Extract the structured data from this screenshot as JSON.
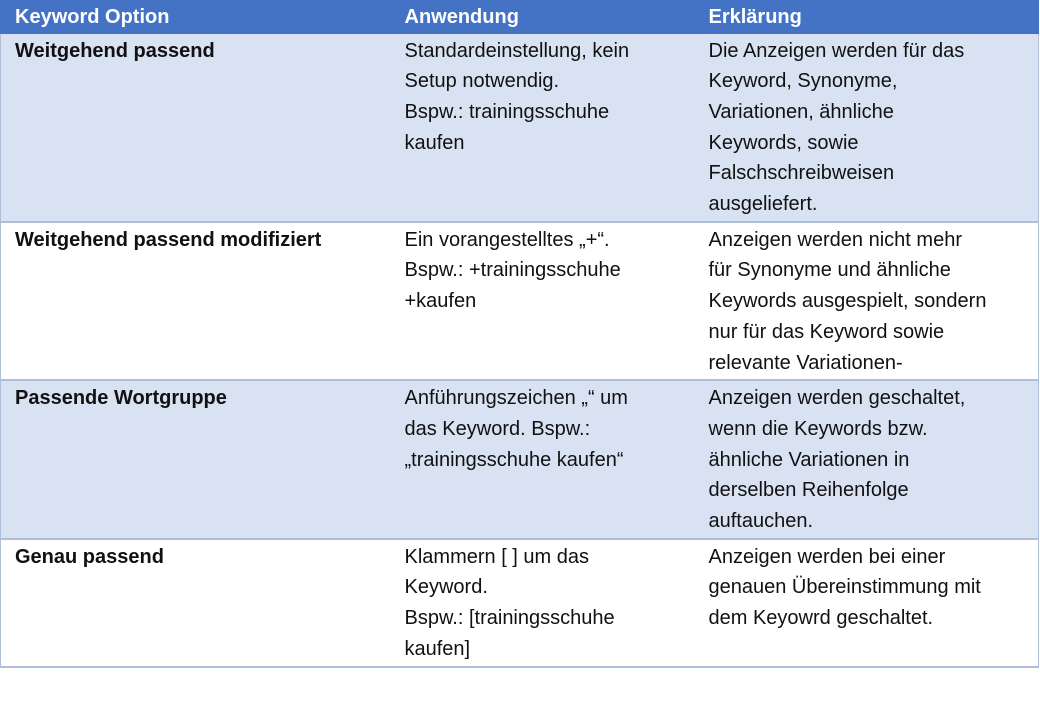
{
  "colors": {
    "header_bg": "#4472c4",
    "band_bg": "#d9e2f3",
    "plain_bg": "#ffffff",
    "border": "#aebfd9"
  },
  "table": {
    "headers": [
      "Keyword Option",
      "Anwendung",
      "Erklärung"
    ],
    "rows": [
      {
        "option": "Weitgehend passend",
        "anwendung": [
          "Standardeinstellung, kein",
          "Setup notwendig.",
          "Bspw.: trainingsschuhe",
          "kaufen"
        ],
        "erklaerung": [
          "Die Anzeigen werden für das",
          "Keyword, Synonyme,",
          "Variationen, ähnliche",
          "Keywords, sowie",
          "Falschschreibweisen",
          "ausgeliefert."
        ]
      },
      {
        "option": "Weitgehend passend modifiziert",
        "anwendung": [
          "Ein vorangestelltes „+“.",
          "Bspw.: +trainingsschuhe",
          "+kaufen"
        ],
        "erklaerung": [
          "Anzeigen werden nicht mehr",
          "für Synonyme und ähnliche",
          "Keywords ausgespielt, sondern",
          "nur für das Keyword sowie",
          "relevante Variationen-"
        ]
      },
      {
        "option": "Passende Wortgruppe",
        "anwendung": [
          "Anführungszeichen „“ um",
          "das Keyword. Bspw.:",
          "„trainingsschuhe kaufen“"
        ],
        "erklaerung": [
          "Anzeigen werden geschaltet,",
          "wenn die Keywords bzw.",
          "ähnliche Variationen in",
          "derselben Reihenfolge",
          "auftauchen."
        ]
      },
      {
        "option": "Genau passend",
        "anwendung": [
          "Klammern [ ] um das",
          "Keyword.",
          "Bspw.: [trainingsschuhe",
          "kaufen]"
        ],
        "erklaerung": [
          "Anzeigen werden bei einer",
          "genauen Übereinstimmung mit",
          "dem Keyowrd geschaltet."
        ]
      }
    ]
  }
}
